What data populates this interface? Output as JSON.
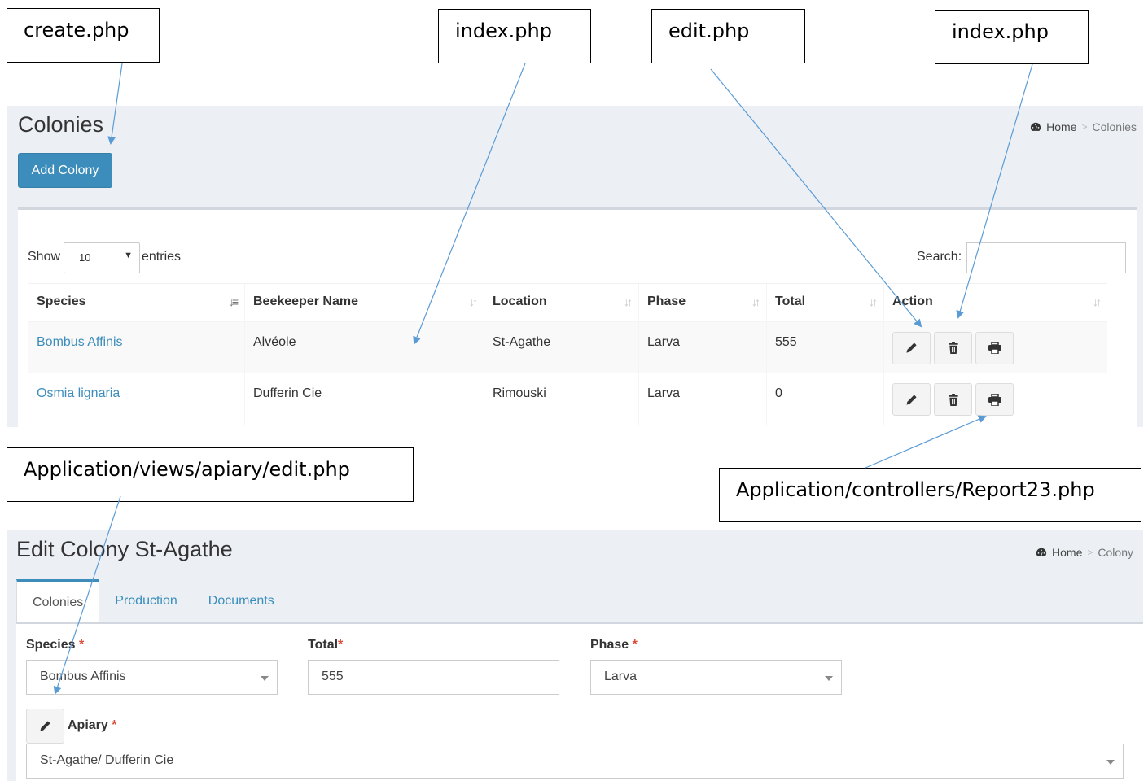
{
  "callouts": {
    "create": "create.php",
    "index_left": "index.php",
    "edit": "edit.php",
    "index_right": "index.php",
    "apiary_edit": "Application/views/apiary/edit.php",
    "report": "Application/controllers/Report23.php"
  },
  "colonies_page": {
    "title": "Colonies",
    "breadcrumb": {
      "home": "Home",
      "separator": ">",
      "current": "Colonies"
    },
    "add_button": "Add Colony",
    "length_menu": {
      "prefix": "Show",
      "value": "10",
      "suffix": "entries"
    },
    "search_label": "Search:",
    "search_value": "",
    "columns": [
      "Species",
      "Beekeeper Name",
      "Location",
      "Phase",
      "Total",
      "Action"
    ],
    "rows": [
      {
        "species": "Bombus Affinis",
        "beekeeper": "Alvéole",
        "location": "St-Agathe",
        "phase": "Larva",
        "total": "555"
      },
      {
        "species": "Osmia lignaria",
        "beekeeper": "Dufferin Cie",
        "location": "Rimouski",
        "phase": "Larva",
        "total": "0"
      }
    ]
  },
  "edit_page": {
    "title": "Edit Colony St-Agathe",
    "breadcrumb": {
      "home": "Home",
      "separator": ">",
      "current": "Colony"
    },
    "tabs": [
      "Colonies",
      "Production",
      "Documents"
    ],
    "active_tab": 0,
    "fields": {
      "species_label": "Species",
      "species_value": "Bombus Affinis",
      "total_label": "Total",
      "total_value": "555",
      "phase_label": "Phase",
      "phase_value": "Larva",
      "apiary_label": "Apiary",
      "apiary_value": "St-Agathe/ Dufferin Cie",
      "required_mark": "*"
    }
  },
  "colors": {
    "accent": "#3c8dbc",
    "panel_bg": "#ecf0f5",
    "required": "#dd4b39",
    "arrow": "#5b9bd5"
  }
}
